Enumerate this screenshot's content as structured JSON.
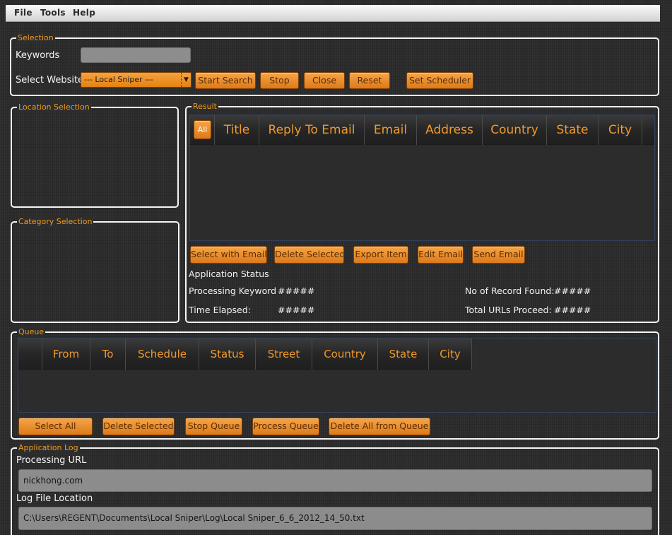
{
  "menu": [
    "File",
    "Tools",
    "Help"
  ],
  "selection": {
    "legend": "Selection",
    "keywords_label": "Keywords",
    "keywords_value": "",
    "website_label": "Select Website",
    "website_value": "--- Local Sniper ---",
    "buttons": {
      "start_search": "Start Search",
      "stop": "Stop",
      "close": "Close",
      "reset": "Reset",
      "set_scheduler": "Set Scheduler"
    }
  },
  "location_legend": "Location Selection",
  "category_legend": "Category Selection",
  "result": {
    "legend": "Result",
    "all_label": "All",
    "columns": [
      "Title",
      "Reply To Email",
      "Email",
      "Address",
      "Country",
      "State",
      "City"
    ],
    "buttons": {
      "select_with_email": "Select with Email",
      "delete_selected": "Delete Selected",
      "export_item": "Export Item",
      "edit_email": "Edit Email",
      "send_email": "Send Email"
    },
    "status_heading": "Application Status",
    "processing_keyword_label": "Processing Keyword",
    "processing_keyword_value": "#####",
    "time_elapsed_label": "Time Elapsed:",
    "time_elapsed_value": "#####",
    "records_found_label": "No of Record Found:",
    "records_found_value": "#####",
    "urls_proceed_label": "Total URLs Proceed:",
    "urls_proceed_value": "#####"
  },
  "queue": {
    "legend": "Queue",
    "columns": [
      "",
      "From",
      "To",
      "Schedule",
      "Status",
      "Street",
      "Country",
      "State",
      "City"
    ],
    "buttons": {
      "select_all": "Select All",
      "delete_selected": "Delete Selected",
      "stop_queue": "Stop Queue",
      "process_queue": "Process Queue",
      "delete_all": "Delete All from Queue"
    }
  },
  "log": {
    "legend": "Application Log",
    "processing_url_label": "Processing URL",
    "processing_url_value": "nickhong.com",
    "log_file_label": "Log File Location",
    "log_file_value": "C:\\Users\\REGENT\\Documents\\Local Sniper\\Log\\Local Sniper_6_6_2012_14_50.txt"
  },
  "colors": {
    "accent": "#f39a1d",
    "button": "#e98c28",
    "border": "#f4f4f4",
    "background": "#2b2b2b"
  }
}
